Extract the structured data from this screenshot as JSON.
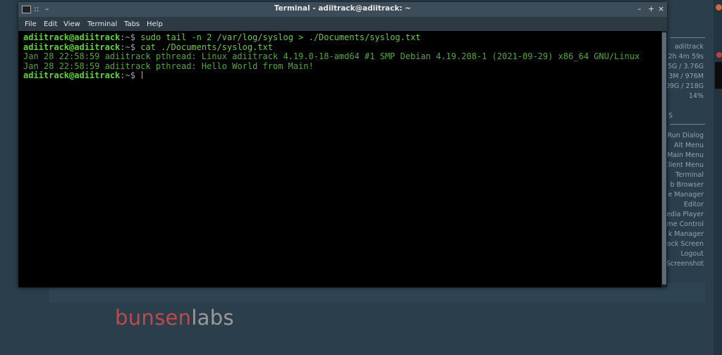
{
  "window": {
    "title": "Terminal - adiitrack@adiitrack: ~",
    "menu_icon": "window-menu-icon",
    "controls": [
      "–",
      "+",
      "×"
    ]
  },
  "menu": [
    "File",
    "Edit",
    "View",
    "Terminal",
    "Tabs",
    "Help"
  ],
  "terminal": {
    "lines": [
      {
        "user": "adiitrack@adiitrack",
        "path": ":~$ ",
        "cmd": "sudo tail -n 2 /var/log/syslog > ./Documents/syslog.txt"
      },
      {
        "user": "adiitrack@adiitrack",
        "path": ":~$ ",
        "cmd": "cat ./Documents/syslog.txt"
      },
      {
        "output": "Jan 28 22:58:59 adiitrack pthread: Linux adiitrack 4.19.0-18-amd64 #1 SMP Debian 4.19.208-1 (2021-09-29) x86_64 GNU/Linux"
      },
      {
        "output": "Jan 28 22:58:59 adiitrack pthread: Hello World from Main!"
      },
      {
        "user": "adiitrack@adiitrack",
        "path": ":~$ ",
        "cmd": ""
      }
    ]
  },
  "conky": {
    "hostname": "adiitrack",
    "uptime": "2h 4m 59s",
    "ram": "5G / 3.76G",
    "swap": "3M / 976M",
    "disk": "09G / 218G",
    "cpu": "14%",
    "section": "S",
    "shortcuts": [
      "Run Dialog",
      "Alt Menu",
      "Main Menu",
      "Client Menu",
      "Terminal",
      "b Browser",
      "e Manager",
      "Editor",
      "edia Player",
      "me Control",
      "k Manager",
      "ock Screen",
      "Logout",
      "Screenshot"
    ]
  },
  "desktop": {
    "logo_a": "bunsen",
    "logo_b": "labs"
  },
  "colors": {
    "desktop": "#2b3e4b",
    "prompt_user": "#5fd33b",
    "output": "#4fa838",
    "logo_red": "#c0494a"
  }
}
